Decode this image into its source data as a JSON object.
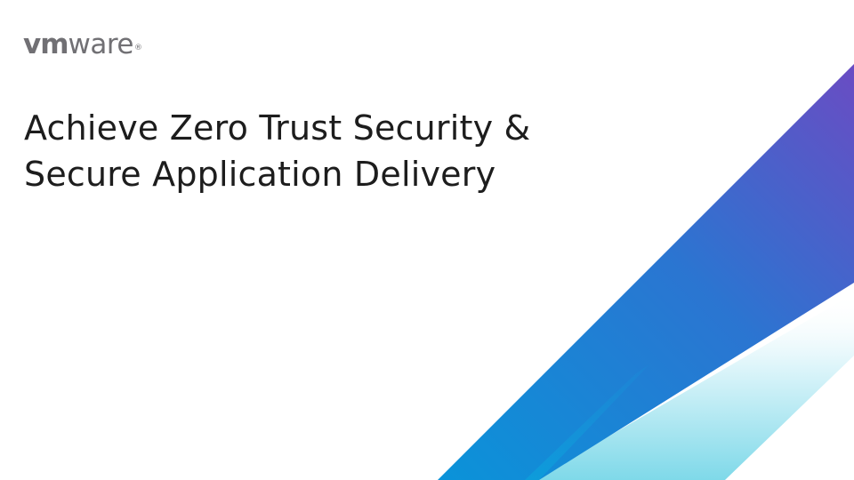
{
  "brand": {
    "logo_vm": "vm",
    "logo_ware": "ware",
    "logo_reg": "®",
    "logo_color": "#717074"
  },
  "slide": {
    "title_line1": "Achieve Zero Trust Security &",
    "title_line2": "Secure Application Delivery",
    "title_color": "#1d1d1d"
  },
  "colors": {
    "band_top": "#6a4fc2",
    "band_mid": "#2f72d0",
    "band_bottom": "#0e92d8",
    "light_band_top": "#ffffff",
    "light_band_bottom": "#7fd9e9"
  }
}
